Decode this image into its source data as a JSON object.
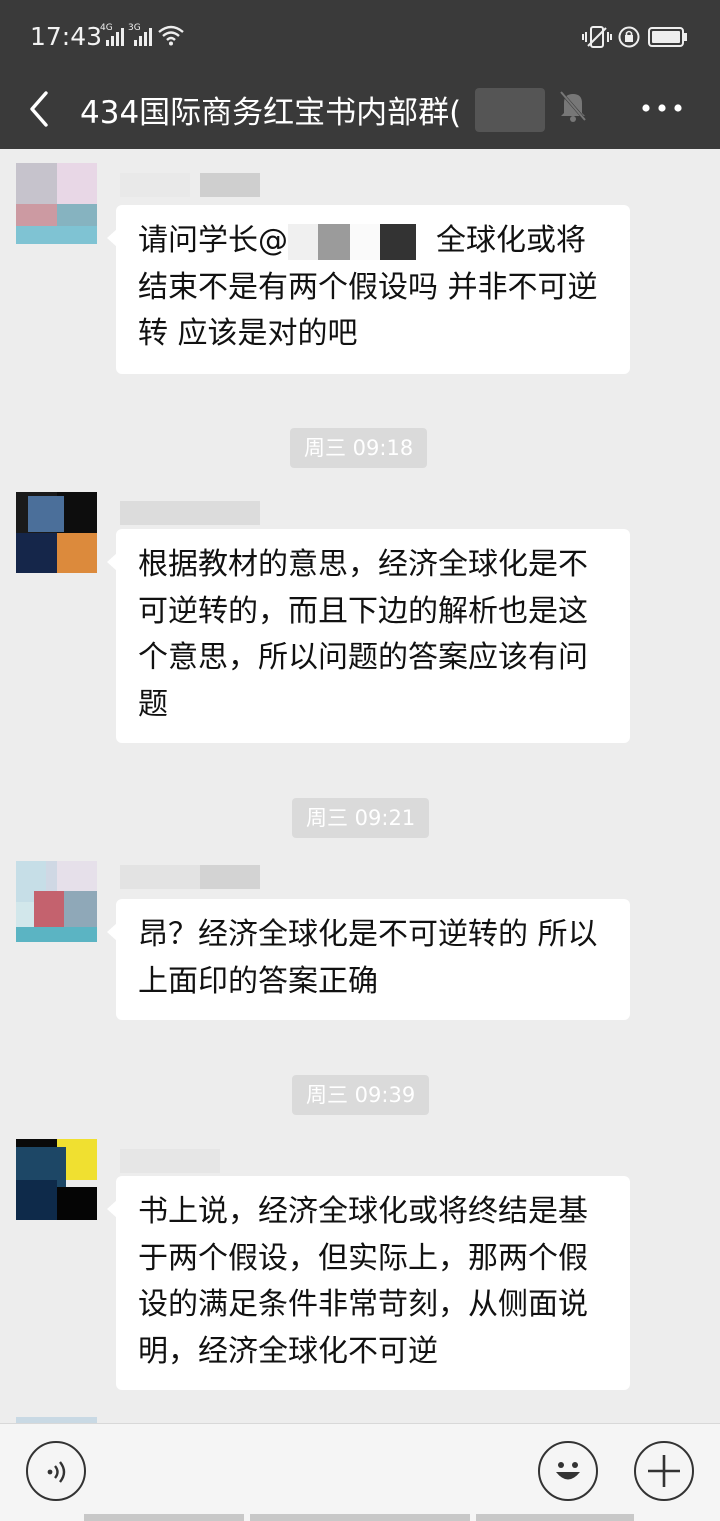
{
  "status_bar": {
    "time": "17:43",
    "net1": "4G",
    "net2": "3G"
  },
  "header": {
    "title": "434国际商务红宝书内部群(",
    "icons": [
      "back-arrow-icon",
      "mute-bell-icon",
      "more-icon"
    ]
  },
  "messages": [
    {
      "parts": [
        "请问学长@",
        "全球化或将结束不是有两个假设吗 并非不可逆转 应该是对的吧"
      ]
    },
    {
      "timestamp": "周三 09:18",
      "text": "根据教材的意思，经济全球化是不可逆转的，而且下边的解析也是这个意思，所以问题的答案应该有问题"
    },
    {
      "timestamp": "周三 09:21",
      "text": "昂？经济全球化是不可逆转的 所以上面印的答案正确"
    },
    {
      "timestamp": "周三 09:39",
      "text": "书上说，经济全球化或将终结是基于两个假设，但实际上，那两个假设的满足条件非常苛刻，从侧面说明，经济全球化不可逆"
    }
  ],
  "input_bar": {
    "icons": [
      "voice-icon",
      "emoji-icon",
      "plus-icon"
    ]
  },
  "colors": {
    "header_bg": "#3a3a3a",
    "chat_bg": "#ededed",
    "bubble_bg": "#ffffff",
    "timestamp_bg": "#dadada"
  }
}
